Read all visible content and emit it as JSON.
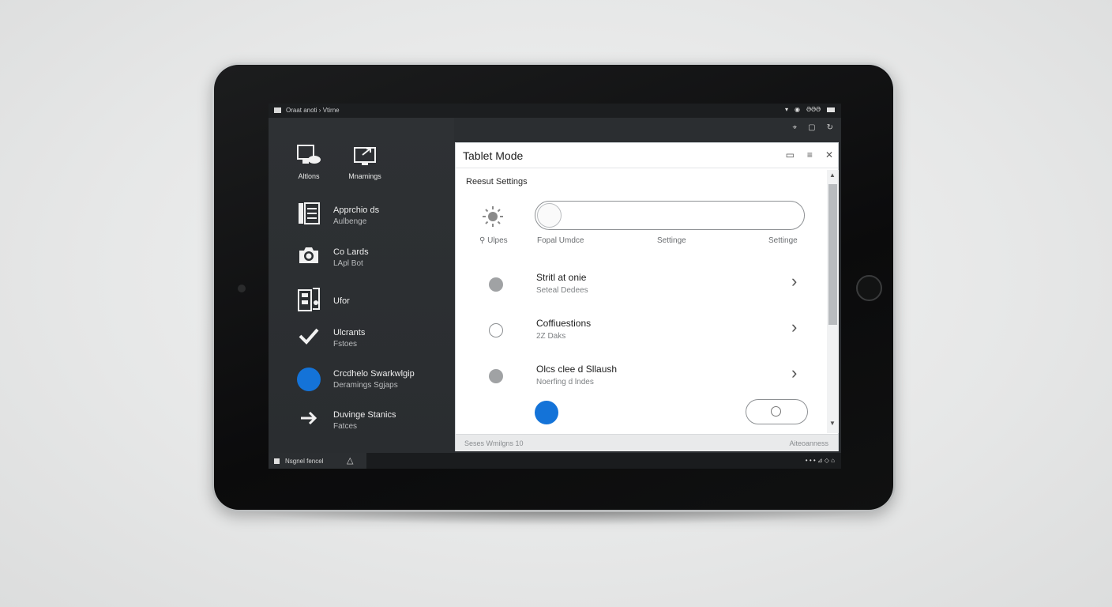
{
  "topbar": {
    "title": "Oraat anoti › Vtirne",
    "sys_icons": [
      "wifi-icon",
      "location-icon",
      "signal-text",
      "battery-icon"
    ],
    "sys_text": "ƏƏƏ"
  },
  "subbar_icons": [
    "pin-icon",
    "square-icon",
    "redo-icon"
  ],
  "sidebar": {
    "tiles": [
      {
        "label": "Altlons",
        "icon": "desktop-cloud-icon"
      },
      {
        "label": "Mnamings",
        "icon": "monitor-share-icon"
      }
    ],
    "items": [
      {
        "line1": "Apprchio ds",
        "line2": "Aulbenge",
        "icon": "document-lines-icon"
      },
      {
        "line1": "Co Lards",
        "line2": "LApl Bot",
        "icon": "camera-icon"
      },
      {
        "line1": "Ufor",
        "line2": "",
        "icon": "device-panel-icon"
      },
      {
        "line1": "Ulcrants",
        "line2": "Fstoes",
        "icon": "checkmark-icon"
      },
      {
        "line1": "Crcdhelo Swarkwlgip",
        "line2": "Deramings Sgjaps",
        "icon": "blue-circle-icon"
      },
      {
        "line1": "Duvinge Stanics",
        "line2": "Fatces",
        "icon": "arrow-right-icon"
      }
    ]
  },
  "dialog": {
    "title": "Tablet Mode",
    "controls": [
      "minimize-icon",
      "menu-icon",
      "close-icon"
    ],
    "section_label": "Reesut Settings",
    "seg_labels": [
      "Ulpes",
      "Fopal Umdce",
      "Settinge",
      "Settinge"
    ],
    "rows": [
      {
        "title": "Stritl at onie",
        "subtitle": "Seteal Dedees",
        "dot": "grey"
      },
      {
        "title": "Coffiuestions",
        "subtitle": "2Z Daks",
        "dot": "hollow"
      },
      {
        "title": "Olcs clee d Sllaush",
        "subtitle": "Noerfing d lndes",
        "dot": "grey"
      }
    ],
    "status_left": "Seses Wmilgns 10",
    "status_right": "Aiteoanness"
  },
  "taskbar": {
    "start_label": "Nsgnel fencel",
    "tray": "• • • ⊿ ◇ ⌂"
  },
  "colors": {
    "accent_blue": "#1473d8",
    "screen_bg": "#2b2e31",
    "dialog_bg": "#ffffff"
  }
}
